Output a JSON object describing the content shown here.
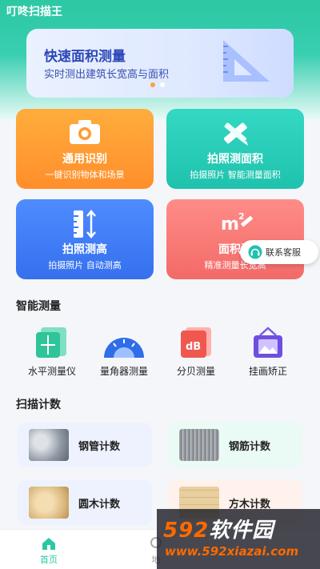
{
  "app": {
    "title": "叮咚扫描王"
  },
  "banner": {
    "title": "快速面积测量",
    "subtitle": "实时测出建筑长宽高与面积"
  },
  "feature_cards": [
    {
      "title": "通用识别",
      "subtitle": "一键识别物体和场景"
    },
    {
      "title": "拍照测面积",
      "subtitle": "拍摄照片 智能测量面积"
    },
    {
      "title": "拍照测高",
      "subtitle": "拍摄照片 自动测高"
    },
    {
      "title": "面积测",
      "subtitle": "精准测量长宽高"
    }
  ],
  "service": {
    "label": "联系客服"
  },
  "smart_section": {
    "title": "智能测量",
    "tools": [
      {
        "label": "水平测量仪"
      },
      {
        "label": "量角器测量"
      },
      {
        "label": "分贝测量",
        "icon_text": "dB"
      },
      {
        "label": "挂画矫正"
      }
    ]
  },
  "scan_section": {
    "title": "扫描计数",
    "items": [
      {
        "label": "钢管计数"
      },
      {
        "label": "钢筋计数"
      },
      {
        "label": "圆木计数"
      },
      {
        "label": "方木计数"
      }
    ]
  },
  "bottom_nav": {
    "home": "首页",
    "second": "地"
  },
  "watermark": {
    "logo_num": "592",
    "logo_text": "软件园",
    "url": "www.592xiazai.com"
  },
  "colors": {
    "accent": "#2cc7a3",
    "banner_text": "#2b47b8",
    "orange": "#ff6a00"
  }
}
